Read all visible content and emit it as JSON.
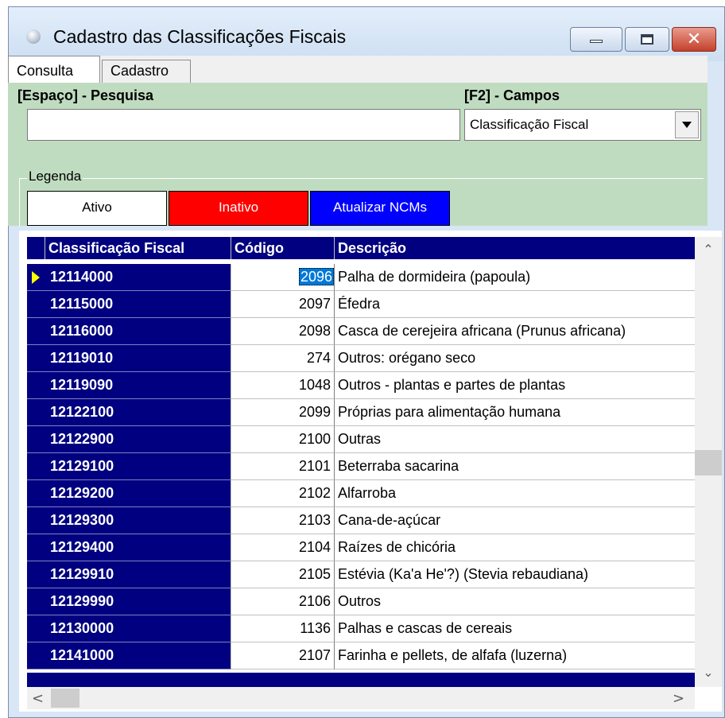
{
  "window": {
    "title": "Cadastro das Classificações Fiscais",
    "close_glyph": "✕"
  },
  "tabs": [
    {
      "label": "Consulta"
    },
    {
      "label": "Cadastro"
    }
  ],
  "search": {
    "label": "[Espaço] - Pesquisa",
    "value": ""
  },
  "fields": {
    "label": "[F2] - Campos",
    "selected": "Classificação Fiscal"
  },
  "legend": {
    "title": "Legenda",
    "items": [
      {
        "label": "Ativo",
        "color": "#ffffff"
      },
      {
        "label": "Inativo",
        "color": "#ff0000"
      },
      {
        "label": "Atualizar NCMs",
        "color": "#0000ff"
      }
    ]
  },
  "grid": {
    "columns": [
      "Classificação Fiscal",
      "Código",
      "Descrição"
    ],
    "rows": [
      {
        "classificacao": "12114000",
        "codigo": "2096",
        "descricao": "Palha de dormideira (papoula)"
      },
      {
        "classificacao": "12115000",
        "codigo": "2097",
        "descricao": "Éfedra"
      },
      {
        "classificacao": "12116000",
        "codigo": "2098",
        "descricao": "Casca de cerejeira africana (Prunus africana)"
      },
      {
        "classificacao": "12119010",
        "codigo": "274",
        "descricao": "Outros: orégano seco"
      },
      {
        "classificacao": "12119090",
        "codigo": "1048",
        "descricao": "Outros - plantas e partes de plantas"
      },
      {
        "classificacao": "12122100",
        "codigo": "2099",
        "descricao": "Próprias para alimentação humana"
      },
      {
        "classificacao": "12122900",
        "codigo": "2100",
        "descricao": "Outras"
      },
      {
        "classificacao": "12129100",
        "codigo": "2101",
        "descricao": "Beterraba sacarina"
      },
      {
        "classificacao": "12129200",
        "codigo": "2102",
        "descricao": "Alfarroba"
      },
      {
        "classificacao": "12129300",
        "codigo": "2103",
        "descricao": "Cana-de-açúcar"
      },
      {
        "classificacao": "12129400",
        "codigo": "2104",
        "descricao": "Raízes de chicória"
      },
      {
        "classificacao": "12129910",
        "codigo": "2105",
        "descricao": "Estévia (Ka'a He'?) (Stevia rebaudiana)"
      },
      {
        "classificacao": "12129990",
        "codigo": "2106",
        "descricao": "Outros"
      },
      {
        "classificacao": "12130000",
        "codigo": "1136",
        "descricao": "Palhas e cascas de cereais"
      },
      {
        "classificacao": "12141000",
        "codigo": "2107",
        "descricao": "Farinha e pellets, de alfafa (luzerna)"
      }
    ]
  },
  "scroll": {
    "up": "⌃",
    "down": "⌄",
    "left": "<",
    "right": ">"
  }
}
